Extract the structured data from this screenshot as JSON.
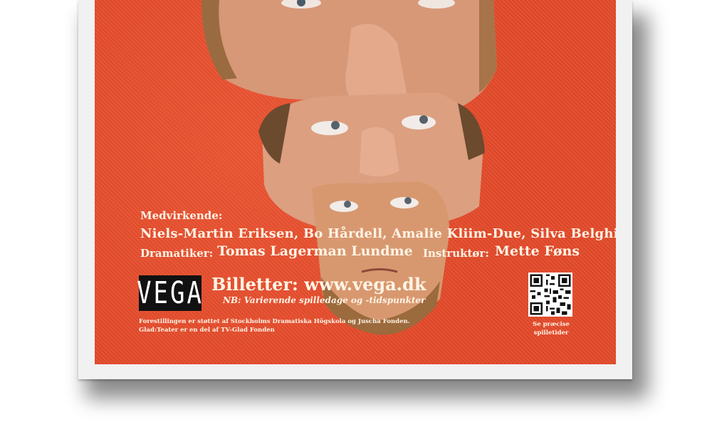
{
  "poster": {
    "cast_label": "Medvirkende:",
    "cast": "Niels-Martin Eriksen, Bo Hårdell, Amalie Kliim-Due, Silva Belghiti",
    "playwright_label": "Dramatiker:",
    "playwright": "Tomas Lagerman Lundme",
    "director_label": "Instruktør:",
    "director": "Mette Føns",
    "logo_text": "VEGA",
    "tickets": "Billetter: www.vega.dk",
    "tickets_note": "NB: Varierende spilledage og -tidspunkter",
    "support_line1": "Forestillingen er støttet af Stockholms Dramatiska Högskola og Juscha Fonden.",
    "support_line2": "Glad:Teater er en del af TV-Glad Fonden",
    "qr_caption_line1": "Se præcise",
    "qr_caption_line2": "spilletider"
  },
  "colors": {
    "poster_background": "#e54c2c",
    "text": "#fff4e6",
    "frame": "#f1f1f1"
  }
}
